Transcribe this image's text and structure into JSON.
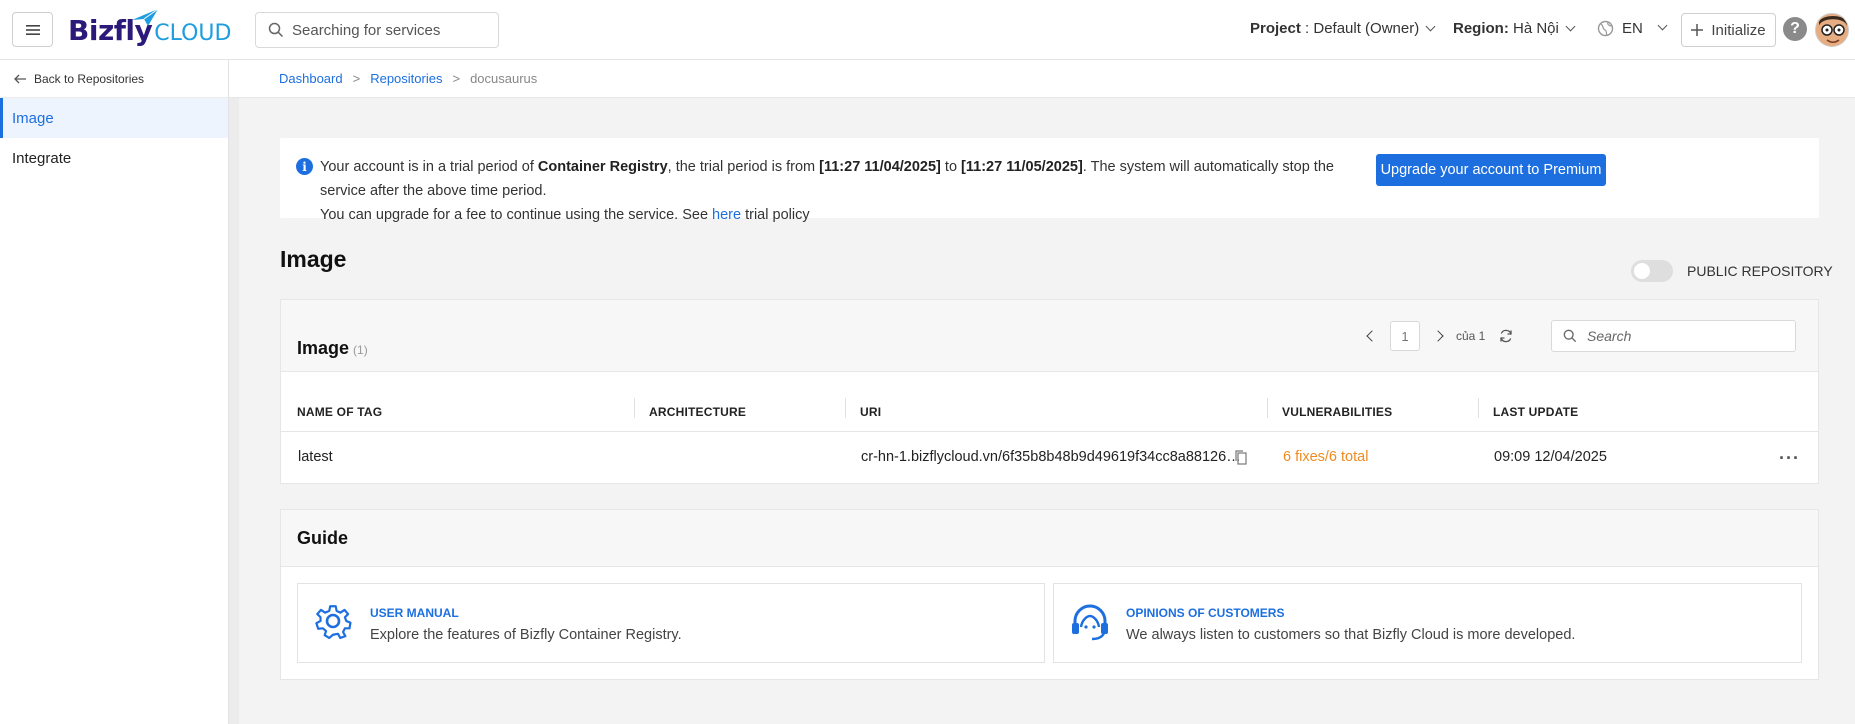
{
  "header": {
    "brand_main": "Bizfly",
    "brand_sub": "CLOUD",
    "search_placeholder": "Searching for services",
    "project_label": "Project",
    "project_value": " : Default (Owner)",
    "region_label": "Region:",
    "region_value": " Hà Nội",
    "language": "EN",
    "initialize_label": "Initialize",
    "help": "?"
  },
  "sidebar": {
    "back_label": "Back to Repositories",
    "items": [
      {
        "label": "Image",
        "active": true
      },
      {
        "label": "Integrate",
        "active": false
      }
    ]
  },
  "breadcrumb": {
    "items": [
      "Dashboard",
      "Repositories",
      "docusaurus"
    ],
    "separator": ">"
  },
  "banner": {
    "t1": "Your account is in a trial period of ",
    "product": "Container Registry",
    "t2": ", the trial period is from ",
    "start": "[11:27 11/04/2025]",
    "t3": " to ",
    "end": "[11:27 11/05/2025]",
    "t4": ". The system will automatically stop the service after the above time period.",
    "t5": "You can upgrade for a fee to continue using the service. See ",
    "link": "here",
    "t6": " trial policy",
    "button": "Upgrade your account to Premium"
  },
  "page": {
    "title": "Image",
    "public_label": "PUBLIC REPOSITORY",
    "public_enabled": false
  },
  "table": {
    "title": "Image",
    "count": "(1)",
    "page": "1",
    "page_of": "của 1",
    "search_placeholder": "Search",
    "columns": [
      "NAME OF TAG",
      "ARCHITECTURE",
      "URI",
      "VULNERABILITIES",
      "LAST UPDATE"
    ],
    "rows": [
      {
        "tag": "latest",
        "architecture": "",
        "uri": "cr-hn-1.bizflycloud.vn/6f35b8b48b9d49619f34cc8a88126…",
        "vulnerabilities": "6 fixes/6 total",
        "last_update": "09:09 12/04/2025"
      }
    ]
  },
  "guide": {
    "title": "Guide",
    "cards": [
      {
        "title": "USER MANUAL",
        "desc": "Explore the features of Bizfly Container Registry.",
        "icon": "gear-icon"
      },
      {
        "title": "OPINIONS OF CUSTOMERS",
        "desc": "We always listen to customers so that Bizfly Cloud is more developed.",
        "icon": "headset-icon"
      }
    ]
  },
  "colors": {
    "accent": "#1d6fe0",
    "warning": "#f08a1f",
    "brand_dark": "#2b1a7a",
    "brand_light": "#1e9de0"
  }
}
